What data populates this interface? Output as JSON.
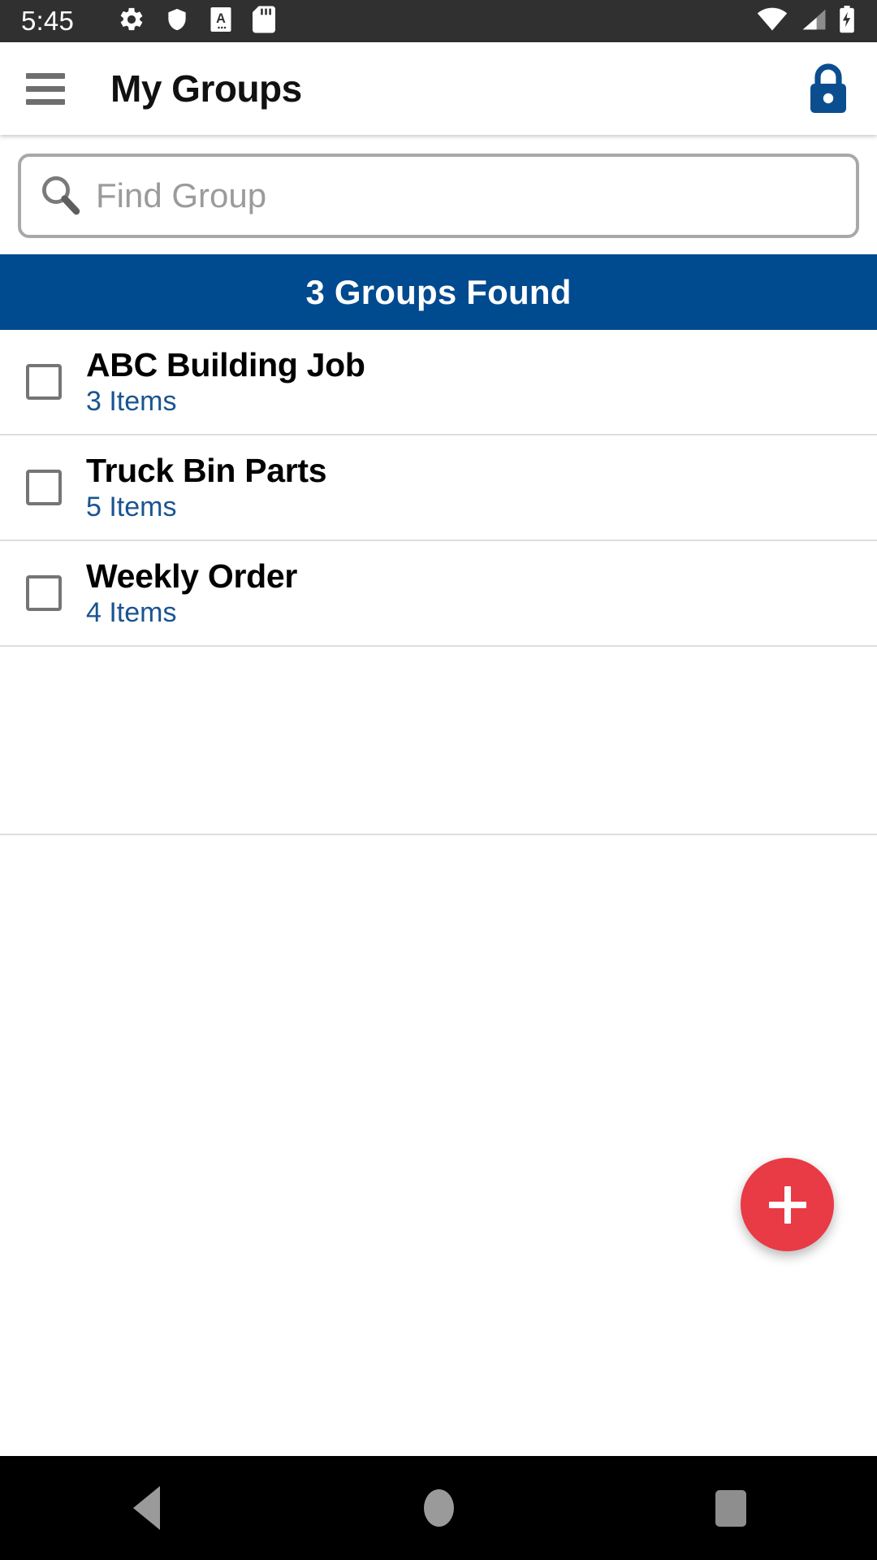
{
  "status_bar": {
    "time": "5:45",
    "left_icons": [
      "gear-icon",
      "shield-icon",
      "document-a-icon",
      "sd-card-icon"
    ],
    "right_icons": [
      "wifi-icon",
      "cellular-signal-icon",
      "battery-charging-icon"
    ],
    "background": "#303030"
  },
  "app_bar": {
    "menu_icon": "hamburger-menu-icon",
    "title": "My Groups",
    "action_icon": "lock-icon",
    "lock_color": "#0A4E8F"
  },
  "search": {
    "icon": "search-icon",
    "value": "",
    "placeholder": "Find Group"
  },
  "banner": {
    "text": "3 Groups Found",
    "background": "#004A8F",
    "text_color": "#FFFFFF"
  },
  "groups": [
    {
      "name": "ABC Building Job",
      "items_label": "3 Items",
      "checked": false
    },
    {
      "name": "Truck Bin Parts",
      "items_label": "5 Items",
      "checked": false
    },
    {
      "name": "Weekly Order",
      "items_label": "4 Items",
      "checked": false
    }
  ],
  "fab": {
    "icon": "plus-icon",
    "color": "#E83B45"
  },
  "nav_bar": {
    "back_icon": "back-triangle-icon",
    "home_icon": "home-circle-icon",
    "recents_icon": "recents-square-icon",
    "background": "#000000"
  },
  "colors": {
    "accent_blue": "#004A8F",
    "sub_text_blue": "#1A5490",
    "fab_red": "#E83B45",
    "divider": "#DEDEDE"
  }
}
